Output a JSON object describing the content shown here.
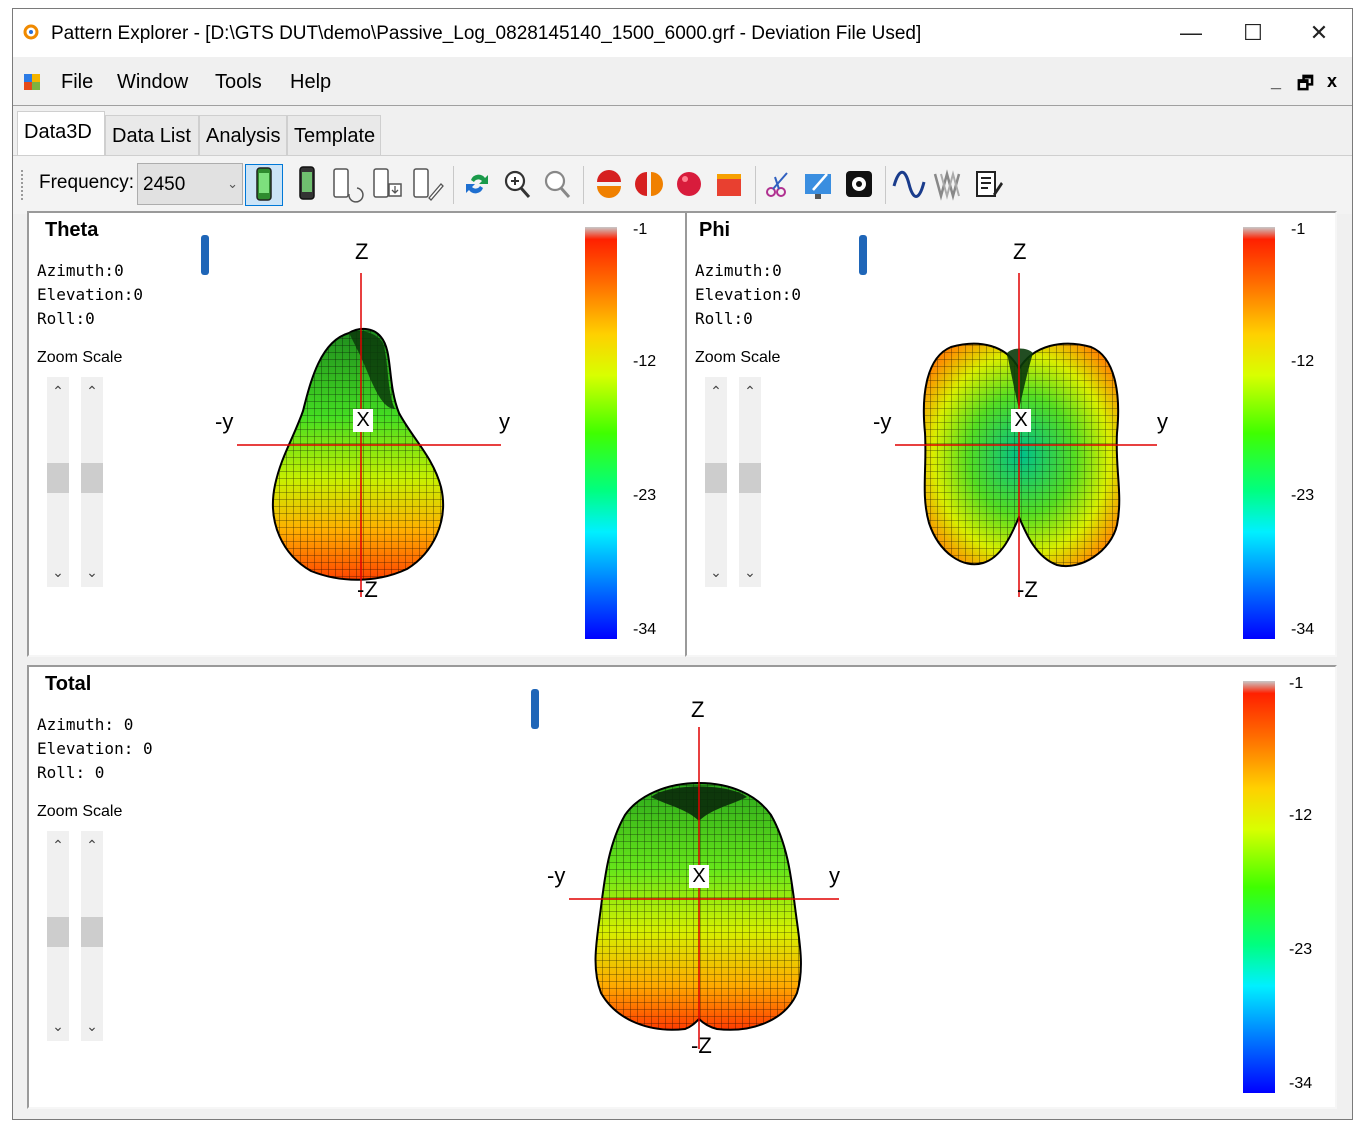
{
  "window": {
    "title": "Pattern Explorer - [D:\\GTS DUT\\demo\\Passive_Log_0828145140_1500_6000.grf - Deviation File Used]",
    "controls": {
      "minimize": "—",
      "maximize": "☐",
      "close": "✕"
    }
  },
  "menu": {
    "items": [
      "File",
      "Window",
      "Tools",
      "Help"
    ],
    "mdi": {
      "minimize": "_",
      "restore": "🗗",
      "close": "x"
    }
  },
  "tabs": [
    "Data3D",
    "Data List",
    "Analysis",
    "Template"
  ],
  "toolbar": {
    "frequency_label": "Frequency:",
    "frequency_value": "2450",
    "icons": [
      "phone-green-icon",
      "phone-dark-icon",
      "phone-rotate-icon",
      "phone-download-icon",
      "phone-edit-icon",
      "rotate-icon",
      "zoom-in-icon",
      "zoom-out-icon",
      "half-sphere-icon",
      "split-sphere-icon",
      "sphere-icon",
      "box-icon",
      "scissors-icon",
      "monitor-tool-icon",
      "gear-icon",
      "sine-wave-icon",
      "multi-wave-icon",
      "notes-icon"
    ]
  },
  "panels": {
    "theta": {
      "title": "Theta",
      "azimuth": "Azimuth:0",
      "elevation": "Elevation:0",
      "roll": "Roll:0",
      "zoom_label": "Zoom Scale",
      "axes": {
        "z": "Z",
        "neg_z": "-Z",
        "y": "y",
        "neg_y": "-y",
        "x": "X"
      },
      "colorbar": [
        "-1",
        "-12",
        "-23",
        "-34"
      ]
    },
    "phi": {
      "title": "Phi",
      "azimuth": "Azimuth:0",
      "elevation": "Elevation:0",
      "roll": "Roll:0",
      "zoom_label": "Zoom Scale",
      "axes": {
        "z": "Z",
        "neg_z": "-Z",
        "y": "y",
        "neg_y": "-y",
        "x": "X"
      },
      "colorbar": [
        "-1",
        "-12",
        "-23",
        "-34"
      ]
    },
    "total": {
      "title": "Total",
      "azimuth": "Azimuth: 0",
      "elevation": "Elevation: 0",
      "roll": "Roll: 0",
      "zoom_label": "Zoom Scale",
      "axes": {
        "z": "Z",
        "neg_z": "-Z",
        "y": "y",
        "neg_y": "-y",
        "x": "X"
      },
      "colorbar": [
        "-1",
        "-12",
        "-23",
        "-34"
      ]
    }
  },
  "colors": {
    "axis": "#e00000",
    "selected": "#0078d7",
    "phone": "#1f66b8"
  }
}
